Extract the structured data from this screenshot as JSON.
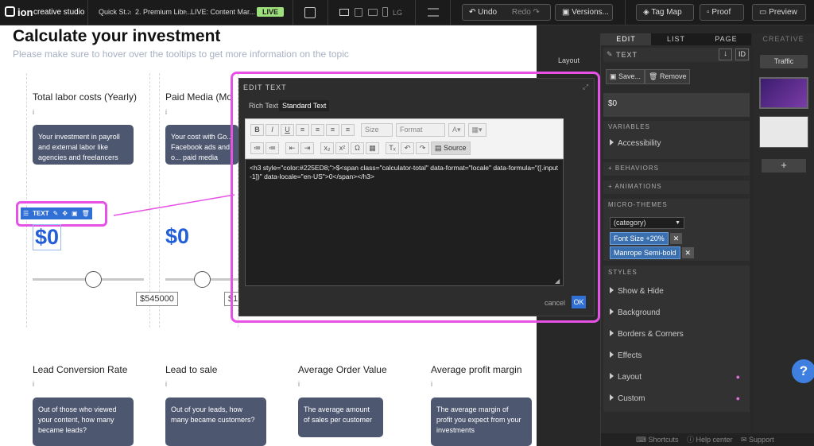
{
  "topbar": {
    "logo": "ion",
    "brand": "creative studio",
    "breadcrumb": [
      "Quick St...",
      "2. Premium Libr...",
      "LIVE: Content Mar..."
    ],
    "live_badge": "LIVE",
    "lg_label": "LG",
    "undo": "Undo",
    "redo": "Redo",
    "versions": "Versions...",
    "tag_map": "Tag Map",
    "proof": "Proof",
    "preview": "Preview"
  },
  "canvas": {
    "title": "Calculate your investment",
    "subtitle": "Please make sure to hover over the tooltips to get more information on the topic",
    "info_glyph": "i",
    "cards": [
      {
        "heading": "Total labor costs (Yearly)",
        "tooltip": "Your investment in payroll and external labor like agencies and freelancers",
        "value": "$0"
      },
      {
        "heading": "Paid Media (Mo",
        "tooltip": "Your cost with Go... Facebook ads and o... paid media",
        "value": "$0"
      }
    ],
    "slider_value": "$545000",
    "slider_value2": "$1",
    "bottom_cards": [
      {
        "heading": "Lead Conversion Rate",
        "tooltip": "Out of those who viewed your content, how many became leads?"
      },
      {
        "heading": "Lead to sale",
        "tooltip": "Out of your leads, how many became customers?"
      },
      {
        "heading": "Average Order Value",
        "tooltip": "The average amount of sales per customer"
      },
      {
        "heading": "Average profit margin",
        "tooltip": "The average margin of profit you expect from your investments"
      }
    ],
    "text_toolbar_label": "TEXT"
  },
  "dialog": {
    "title": "EDIT TEXT",
    "tabs": [
      "Rich Text",
      "Standard Text"
    ],
    "size_label": "Size",
    "format_label": "Format",
    "source_label": "Source",
    "code": "<h3 style=\"color:#225ED8;\">$<span class=\"calculator-total\" data-format=\"locale\" data-formula=\"([.input-1])\" data-locale=\"en-US\">0</span></h3>",
    "cancel": "cancel",
    "ok": "OK"
  },
  "layout_label": "Layout",
  "props": {
    "tabs": [
      "EDIT",
      "LIST",
      "PAGE"
    ],
    "element_type": "TEXT",
    "id_label": "ID",
    "save": "Save...",
    "remove": "Remove",
    "value": "$0",
    "variables": "VARIABLES",
    "accessibility": "Accessibility",
    "behaviors": "+ BEHAVIORS",
    "animations": "+ ANIMATIONS",
    "micro_themes": "MICRO-THEMES",
    "category": "(category)",
    "theme_tags": [
      "Font Size +20%",
      "Manrope Semi-bold"
    ],
    "styles": "STYLES",
    "style_rows": [
      "Show & Hide",
      "Background",
      "Borders & Corners",
      "Effects",
      "Layout",
      "Custom"
    ]
  },
  "creative": {
    "title": "CREATIVE",
    "traffic": "Traffic",
    "add": "+"
  },
  "footer": {
    "shortcuts": "Shortcuts",
    "help": "Help center",
    "support": "Support"
  },
  "help_bubble": "?",
  "colors": {
    "accent": "#225ED8",
    "highlight": "#e652e6",
    "live": "#9ee07c"
  }
}
